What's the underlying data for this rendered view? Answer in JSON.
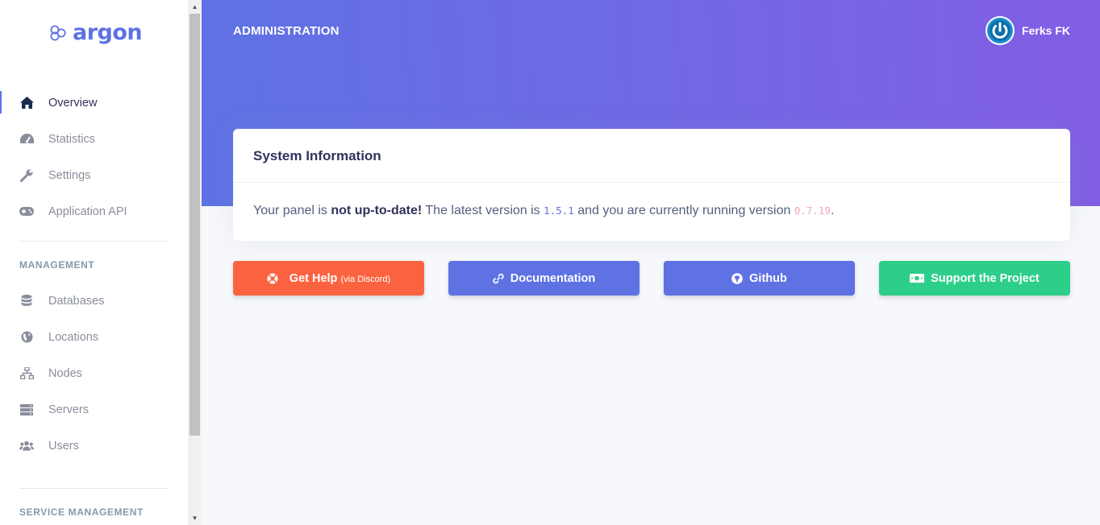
{
  "brand": {
    "name": "argon"
  },
  "sidebar": {
    "nav": [
      {
        "label": "Overview",
        "icon": "home-icon",
        "active": true
      },
      {
        "label": "Statistics",
        "icon": "gauge-icon"
      },
      {
        "label": "Settings",
        "icon": "wrench-icon"
      },
      {
        "label": "Application API",
        "icon": "gamepad-icon"
      }
    ],
    "management_heading": "MANAGEMENT",
    "management": [
      {
        "label": "Databases",
        "icon": "database-icon"
      },
      {
        "label": "Locations",
        "icon": "globe-icon"
      },
      {
        "label": "Nodes",
        "icon": "sitemap-icon"
      },
      {
        "label": "Servers",
        "icon": "server-icon"
      },
      {
        "label": "Users",
        "icon": "users-icon"
      }
    ],
    "service_heading": "SERVICE MANAGEMENT"
  },
  "header": {
    "title": "ADMINISTRATION",
    "user_name": "Ferks FK"
  },
  "system_info": {
    "title": "System Information",
    "message_prefix": "Your panel is ",
    "message_bold": "not up-to-date!",
    "message_middle": " The latest version is ",
    "latest_version": "1.5.1",
    "message_after": " and you are currently running version ",
    "current_version": "0.7.19",
    "message_end": "."
  },
  "buttons": {
    "help": {
      "label": "Get Help",
      "sub": "(via Discord)"
    },
    "docs": {
      "label": "Documentation"
    },
    "github": {
      "label": "Github"
    },
    "support": {
      "label": "Support the Project"
    }
  },
  "colors": {
    "primary": "#5e72e4",
    "gradient_end": "#825ee4",
    "warning": "#fb6340",
    "success": "#2dce89"
  }
}
